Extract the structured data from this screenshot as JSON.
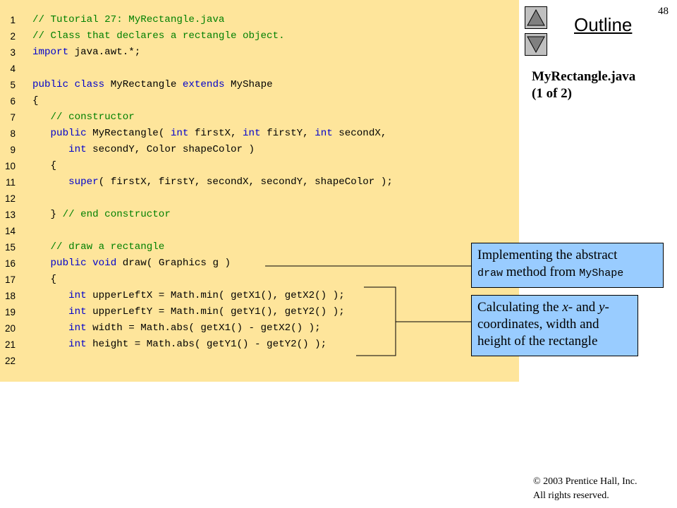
{
  "page_number": "48",
  "outline": {
    "title": "Outline",
    "prev_icon": "triangle-up-icon",
    "next_icon": "triangle-down-icon"
  },
  "file_title": {
    "line1": "MyRectangle.java",
    "line2": "(1 of 2)"
  },
  "code_lines": [
    {
      "num": "1",
      "tokens": [
        {
          "t": "// Tutorial 27: MyRectangle.java",
          "c": "comment"
        }
      ]
    },
    {
      "num": "2",
      "tokens": [
        {
          "t": "// Class that declares a rectangle object.",
          "c": "comment"
        }
      ]
    },
    {
      "num": "3",
      "tokens": [
        {
          "t": "import",
          "c": "keyword"
        },
        {
          "t": " java.awt.*;",
          "c": "plain"
        }
      ]
    },
    {
      "num": "4",
      "tokens": []
    },
    {
      "num": "5",
      "tokens": [
        {
          "t": "public",
          "c": "keyword"
        },
        {
          "t": " ",
          "c": "plain"
        },
        {
          "t": "class",
          "c": "keyword"
        },
        {
          "t": " MyRectangle ",
          "c": "plain"
        },
        {
          "t": "extends",
          "c": "keyword"
        },
        {
          "t": " MyShape",
          "c": "plain"
        }
      ]
    },
    {
      "num": "6",
      "tokens": [
        {
          "t": "{",
          "c": "plain"
        }
      ]
    },
    {
      "num": "7",
      "tokens": [
        {
          "t": "   // constructor",
          "c": "comment"
        }
      ]
    },
    {
      "num": "8",
      "tokens": [
        {
          "t": "   ",
          "c": "plain"
        },
        {
          "t": "public",
          "c": "keyword"
        },
        {
          "t": " MyRectangle( ",
          "c": "plain"
        },
        {
          "t": "int",
          "c": "keyword"
        },
        {
          "t": " firstX, ",
          "c": "plain"
        },
        {
          "t": "int",
          "c": "keyword"
        },
        {
          "t": " firstY, ",
          "c": "plain"
        },
        {
          "t": "int",
          "c": "keyword"
        },
        {
          "t": " secondX,",
          "c": "plain"
        }
      ]
    },
    {
      "num": "9",
      "tokens": [
        {
          "t": "      ",
          "c": "plain"
        },
        {
          "t": "int",
          "c": "keyword"
        },
        {
          "t": " secondY, Color shapeColor )",
          "c": "plain"
        }
      ]
    },
    {
      "num": "10",
      "tokens": [
        {
          "t": "   {",
          "c": "plain"
        }
      ]
    },
    {
      "num": "11",
      "tokens": [
        {
          "t": "      ",
          "c": "plain"
        },
        {
          "t": "super",
          "c": "keyword"
        },
        {
          "t": "( firstX, firstY, secondX, secondY, shapeColor );",
          "c": "plain"
        }
      ]
    },
    {
      "num": "12",
      "tokens": []
    },
    {
      "num": "13",
      "tokens": [
        {
          "t": "   } ",
          "c": "plain"
        },
        {
          "t": "// end constructor",
          "c": "comment"
        }
      ]
    },
    {
      "num": "14",
      "tokens": []
    },
    {
      "num": "15",
      "tokens": [
        {
          "t": "   // draw a rectangle",
          "c": "comment"
        }
      ]
    },
    {
      "num": "16",
      "tokens": [
        {
          "t": "   ",
          "c": "plain"
        },
        {
          "t": "public",
          "c": "keyword"
        },
        {
          "t": " ",
          "c": "plain"
        },
        {
          "t": "void",
          "c": "keyword"
        },
        {
          "t": " draw( Graphics g )",
          "c": "plain"
        }
      ]
    },
    {
      "num": "17",
      "tokens": [
        {
          "t": "   {",
          "c": "plain"
        }
      ]
    },
    {
      "num": "18",
      "tokens": [
        {
          "t": "      ",
          "c": "plain"
        },
        {
          "t": "int",
          "c": "keyword"
        },
        {
          "t": " upperLeftX = Math.min( getX1(), getX2() );",
          "c": "plain"
        }
      ]
    },
    {
      "num": "19",
      "tokens": [
        {
          "t": "      ",
          "c": "plain"
        },
        {
          "t": "int",
          "c": "keyword"
        },
        {
          "t": " upperLeftY = Math.min( getY1(), getY2() );",
          "c": "plain"
        }
      ]
    },
    {
      "num": "20",
      "tokens": [
        {
          "t": "      ",
          "c": "plain"
        },
        {
          "t": "int",
          "c": "keyword"
        },
        {
          "t": " width = Math.abs( getX1() - getX2() );",
          "c": "plain"
        }
      ]
    },
    {
      "num": "21",
      "tokens": [
        {
          "t": "      ",
          "c": "plain"
        },
        {
          "t": "int",
          "c": "keyword"
        },
        {
          "t": " height = Math.abs( getY1() - getY2() );",
          "c": "plain"
        }
      ]
    },
    {
      "num": "22",
      "tokens": []
    }
  ],
  "callouts": {
    "draw": {
      "text1": "Implementing the abstract",
      "mono1": "draw",
      "text2": " method from ",
      "mono2": "MyShape"
    },
    "coords": {
      "line1_a": "Calculating the ",
      "line1_x": "x",
      "line1_b": "- and ",
      "line1_y": "y",
      "line1_c": "-",
      "line2": "coordinates, width and",
      "line3": "height of the rectangle"
    }
  },
  "copyright": {
    "line1": "© 2003 Prentice Hall, Inc.",
    "line2": "All rights reserved."
  },
  "colors": {
    "code_background": "#fee59b",
    "comment": "#008000",
    "keyword": "#0000cc",
    "callout_background": "#99ccff",
    "nav_button": "#c0c0c0"
  }
}
